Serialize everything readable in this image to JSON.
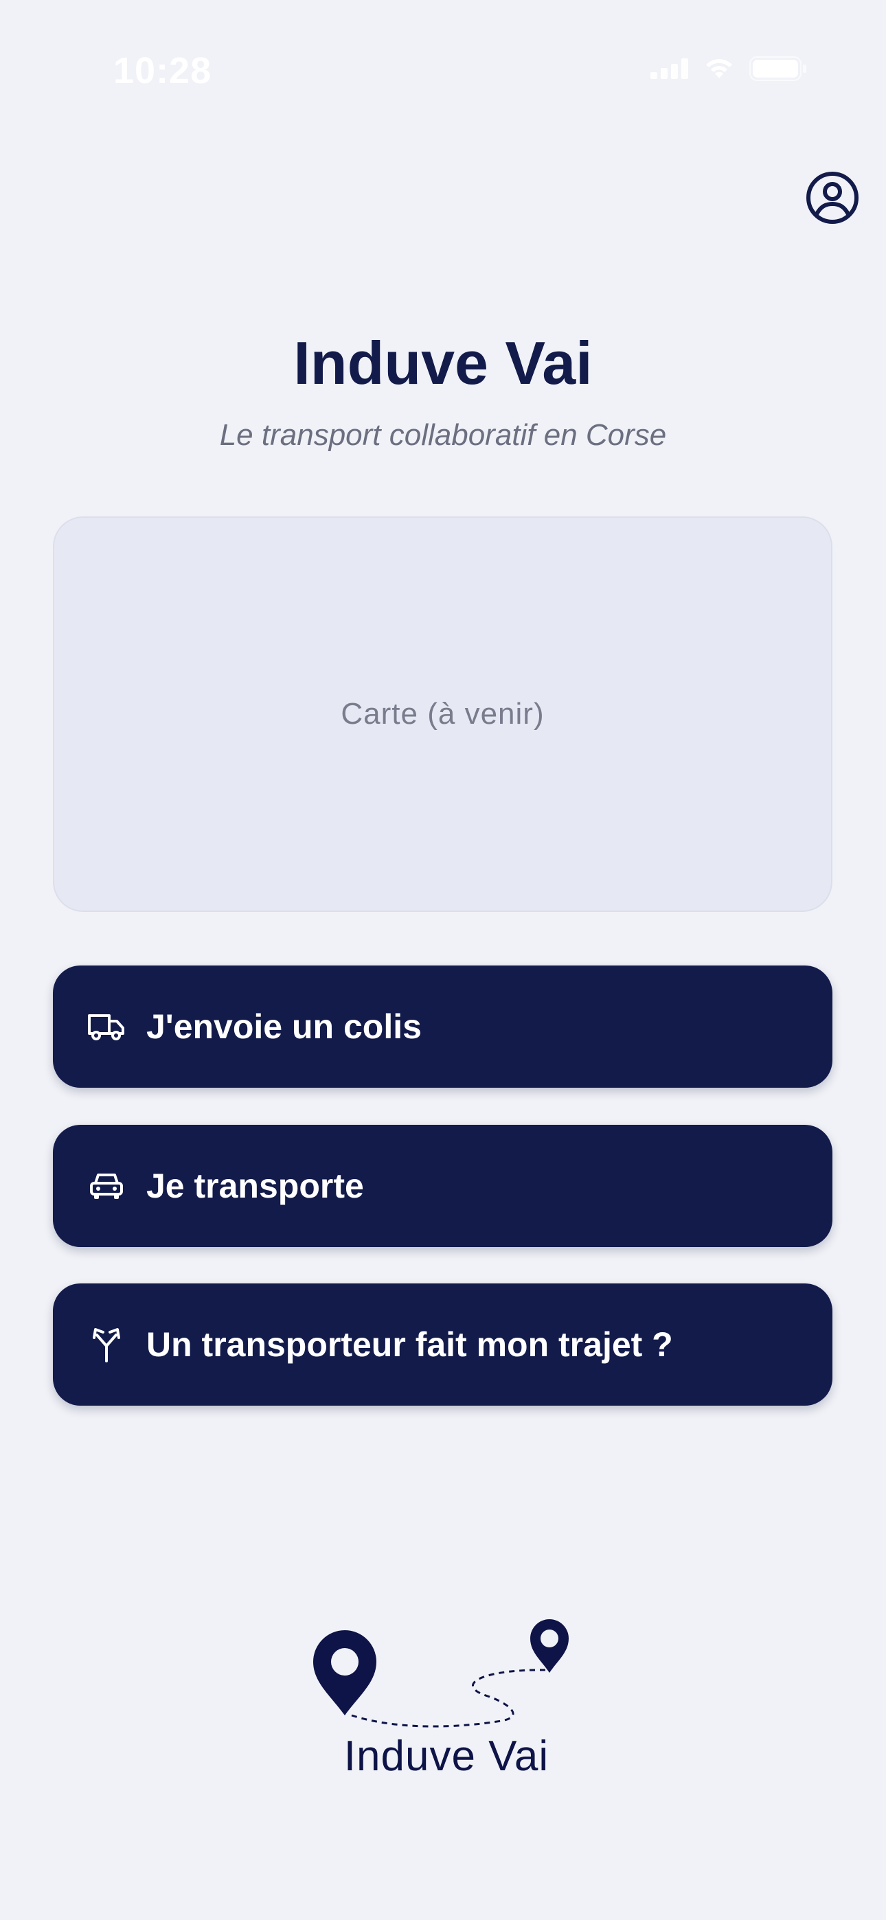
{
  "status_bar": {
    "time": "10:28"
  },
  "header": {
    "profile_icon": "user-circle-icon"
  },
  "main": {
    "title": "Induve Vai",
    "subtitle": "Le transport collaboratif en Corse",
    "map_placeholder": "Carte (à venir)",
    "actions": [
      {
        "label": "J'envoie un colis",
        "icon": "truck-icon"
      },
      {
        "label": "Je transporte",
        "icon": "car-icon"
      },
      {
        "label": "Un transporteur fait mon trajet ?",
        "icon": "route-split-icon"
      }
    ]
  },
  "footer": {
    "logo_text": "Induve Vai",
    "logo_icon": "route-pins-icon"
  },
  "colors": {
    "background": "#f1f2f7",
    "primary": "#121b4a",
    "map_card": "#e6e8f4",
    "subtitle": "#6b6f80"
  }
}
